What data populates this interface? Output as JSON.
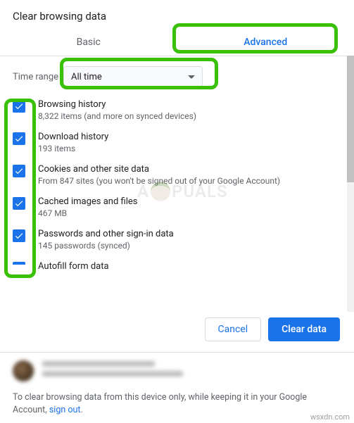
{
  "title": "Clear browsing data",
  "tabs": {
    "basic": "Basic",
    "advanced": "Advanced"
  },
  "timeRange": {
    "label": "Time range",
    "value": "All time"
  },
  "items": [
    {
      "title": "Browsing history",
      "sub": "8,322 items (and more on synced devices)"
    },
    {
      "title": "Download history",
      "sub": "193 items"
    },
    {
      "title": "Cookies and other site data",
      "sub": "From 847 sites (you won't be signed out of your Google Account)"
    },
    {
      "title": "Cached images and files",
      "sub": "467 MB"
    },
    {
      "title": "Passwords and other sign-in data",
      "sub": "145 passwords (synced)"
    },
    {
      "title": "Autofill form data",
      "sub": ""
    }
  ],
  "buttons": {
    "cancel": "Cancel",
    "clear": "Clear data"
  },
  "footer": {
    "text_a": "To clear browsing data from this device only, while keeping it in your Google Account, ",
    "link": "sign out",
    "text_b": "."
  },
  "watermark": {
    "a": "A",
    "b": "PUALS"
  },
  "domain": "wsxdn.com"
}
